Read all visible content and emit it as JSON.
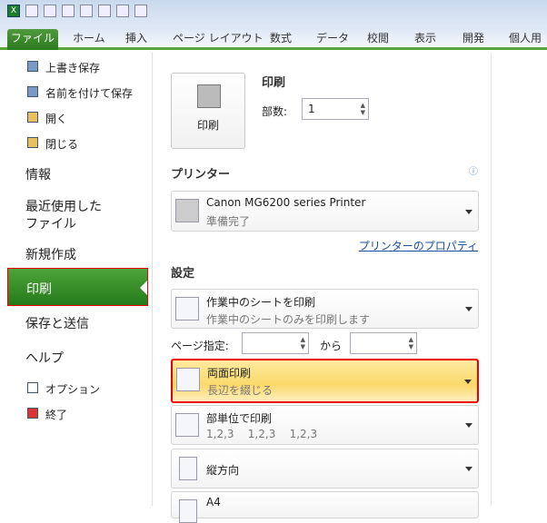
{
  "qat": {
    "app_icon": "X"
  },
  "ribbon": {
    "tabs": [
      "ファイル",
      "ホーム",
      "挿入",
      "ページ レイアウト",
      "数式",
      "データ",
      "校閲",
      "表示",
      "開発",
      "個人用"
    ]
  },
  "left": {
    "save": "上書き保存",
    "save_as": "名前を付けて保存",
    "open": "開く",
    "close": "閉じる",
    "info": "情報",
    "recent_1": "最近使用した",
    "recent_2": "ファイル",
    "new": "新規作成",
    "print": "印刷",
    "save_send": "保存と送信",
    "help": "ヘルプ",
    "options": "オプション",
    "exit": "終了"
  },
  "print": {
    "button": "印刷",
    "title": "印刷",
    "copies_label": "部数:",
    "copies": "1"
  },
  "printer": {
    "heading": "プリンター",
    "name": "Canon MG6200 series Printer",
    "status": "準備完了",
    "properties": "プリンターのプロパティ"
  },
  "settings": {
    "heading": "設定",
    "sheet_title": "作業中のシートを印刷",
    "sheet_sub": "作業中のシートのみを印刷します",
    "pages_label": "ページ指定:",
    "from": "から",
    "duplex_title": "両面印刷",
    "duplex_sub": "長辺を綴じる",
    "collate_title": "部単位で印刷",
    "collate_sub": "1,2,3    1,2,3    1,2,3",
    "orientation": "縦方向",
    "paper": "A4"
  },
  "colors": {
    "accent": "#2c7a1e",
    "highlight": "#fde38a",
    "border": "#e00000"
  }
}
